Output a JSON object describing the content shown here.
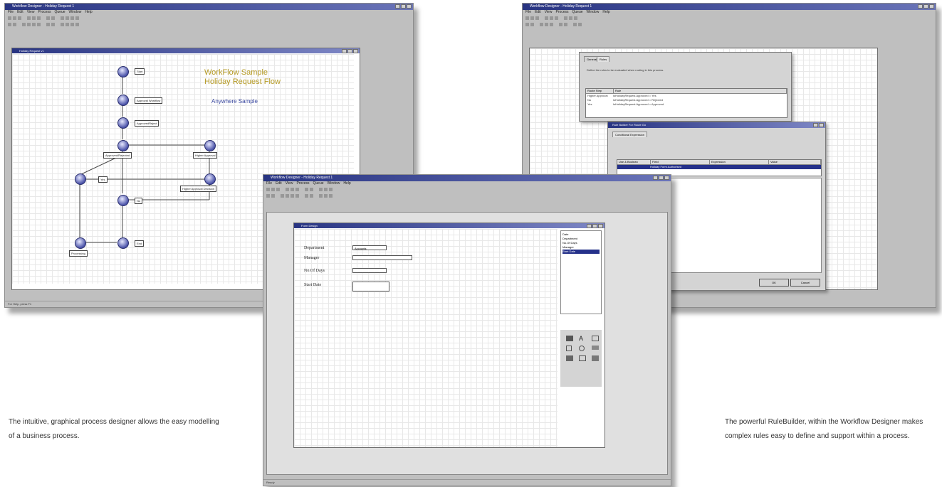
{
  "left_window": {
    "title": "Workflow Designer - Holiday Request 1",
    "menu": [
      "File",
      "Edit",
      "View",
      "Process",
      "Queue",
      "Window",
      "Help"
    ],
    "child_title": "Holiday Request v1",
    "heading_line1": "WorkFlow Sample",
    "heading_line2": "Holiday Request Flow",
    "subheading": "Anywhere Sample",
    "nodes": [
      {
        "label": "Start"
      },
      {
        "label": "Approval Workflow"
      },
      {
        "label": "ApprovedReject"
      },
      {
        "label": "Approved/Rejected"
      },
      {
        "label": "Higher Approval"
      },
      {
        "label": "Yes"
      },
      {
        "label": "Higher Approval Decision"
      },
      {
        "label": "No"
      },
      {
        "label": "Processing"
      },
      {
        "label": "End"
      }
    ],
    "status": "For Help, press F1"
  },
  "right_window": {
    "title": "Workflow Designer - Holiday Request 1",
    "menu": [
      "File",
      "Edit",
      "View",
      "Process",
      "Queue",
      "Window",
      "Help"
    ],
    "dialog1": {
      "tabs": [
        "General",
        "Rules"
      ],
      "instruction": "Define the rules to be evaluated when routing in this process.",
      "columns": [
        "Route Step",
        "Rule"
      ],
      "rows": [
        {
          "step": "Higher Approval",
          "rule": "IsHolidayRequest.Approved = Yes"
        },
        {
          "step": "No",
          "rule": "IsHolidayRequest.Approved = Rejected"
        },
        {
          "step": "Yes",
          "rule": "IsHolidayRequest.Approved = Approved"
        }
      ]
    },
    "dialog2": {
      "title": "Rule Builder For Route Go",
      "tab": "Conditional Expression",
      "columns": [
        "Use & Boolean",
        "Field",
        "Expression",
        "Value"
      ],
      "selected_row": "Holiday Form.Authorised",
      "ok": "OK",
      "cancel": "Cancel"
    }
  },
  "center_window": {
    "title": "Workflow Designer - Holiday Request 1",
    "menu": [
      "File",
      "Edit",
      "View",
      "Process",
      "Queue",
      "Window",
      "Help"
    ],
    "form_title": "Form Design",
    "fields": [
      {
        "label": "Department",
        "value": "Accounts"
      },
      {
        "label": "Manager",
        "value": ""
      },
      {
        "label": "No.Of Days",
        "value": ""
      },
      {
        "label": "Start Date",
        "value": ""
      }
    ],
    "list_items": [
      "Date",
      "Department",
      "No.Of Days",
      "Manager",
      "Start Date"
    ],
    "palette_icons": [
      "text-icon",
      "label-icon",
      "button-icon",
      "checkbox-icon",
      "radio-icon",
      "combo-icon",
      "table-icon",
      "list-icon",
      "grid-icon"
    ],
    "status": "Ready"
  },
  "captions": {
    "left": "The intuitive, graphical process designer allows the easy modelling of a business process.",
    "right": "The powerful RuleBuilder, within the Workflow Designer makes complex rules easy to define and support within a process."
  }
}
